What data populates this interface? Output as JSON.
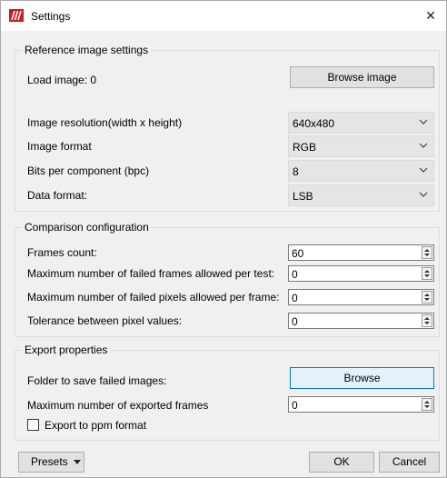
{
  "window": {
    "title": "Settings",
    "close_glyph": "✕"
  },
  "reference": {
    "title": "Reference image settings",
    "load_image_label": "Load image: 0",
    "browse_image_label": "Browse image",
    "resolution": {
      "label": "Image resolution(width x height)",
      "value": "640x480"
    },
    "format": {
      "label": "Image format",
      "value": "RGB"
    },
    "bpc": {
      "label": "Bits per component (bpc)",
      "value": "8"
    },
    "data_format": {
      "label": "Data format:",
      "value": "LSB"
    }
  },
  "comparison": {
    "title": "Comparison configuration",
    "frames_count": {
      "label": "Frames count:",
      "value": "60"
    },
    "max_failed_frames": {
      "label": "Maximum number of failed frames allowed per test:",
      "value": "0"
    },
    "max_failed_pixels": {
      "label": "Maximum number of failed pixels allowed per frame:",
      "value": "0"
    },
    "tolerance": {
      "label": "Tolerance between pixel values:",
      "value": "0"
    }
  },
  "export": {
    "title": "Export properties",
    "folder_label": "Folder to save failed images:",
    "browse_label": "Browse",
    "max_exported": {
      "label": "Maximum number of exported frames",
      "value": "0"
    },
    "ppm_label": "Export to ppm format",
    "ppm_checked": false
  },
  "footer": {
    "presets_label": "Presets",
    "ok_label": "OK",
    "cancel_label": "Cancel"
  },
  "colors": {
    "app_icon_red": "#cc1b1b",
    "focus_border": "#0078d7"
  }
}
